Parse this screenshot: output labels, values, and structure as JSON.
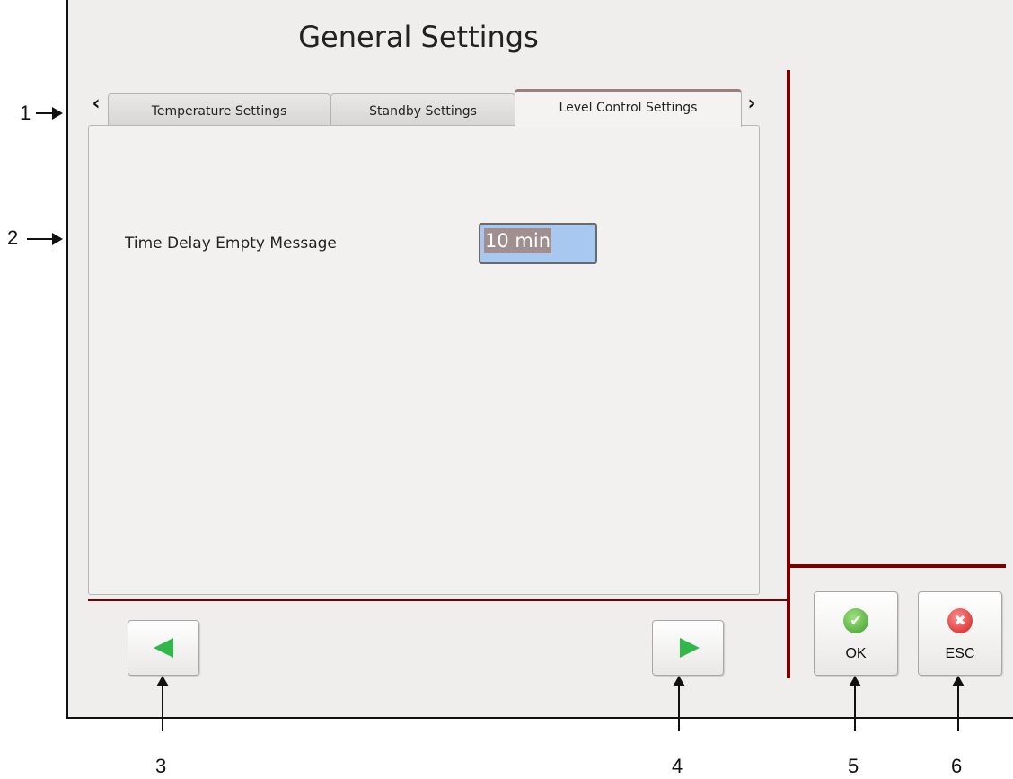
{
  "header": {
    "title": "General Settings"
  },
  "tabs": {
    "items": [
      {
        "label": "Temperature Settings"
      },
      {
        "label": "Standby Settings"
      },
      {
        "label": "Level Control Settings"
      }
    ],
    "active": "Level Control Settings",
    "prev_icon": "chevron-left-icon",
    "next_icon": "chevron-right-icon"
  },
  "panel": {
    "field_label": "Time Delay Empty Message",
    "field_value": "10 min"
  },
  "nav": {
    "prev_icon": "green-left-arrow-icon",
    "next_icon": "green-right-arrow-icon"
  },
  "actions": {
    "ok_label": "OK",
    "esc_label": "ESC",
    "ok_icon": "check-icon",
    "esc_icon": "close-icon"
  },
  "callouts": [
    "1",
    "2",
    "3",
    "4",
    "5",
    "6"
  ],
  "colors": {
    "divider": "#7a0000",
    "arrow_green": "#32b84a",
    "ok_green": "#3e9e2a",
    "esc_red": "#d21e1e",
    "input_highlight": "#a8c8ef"
  }
}
